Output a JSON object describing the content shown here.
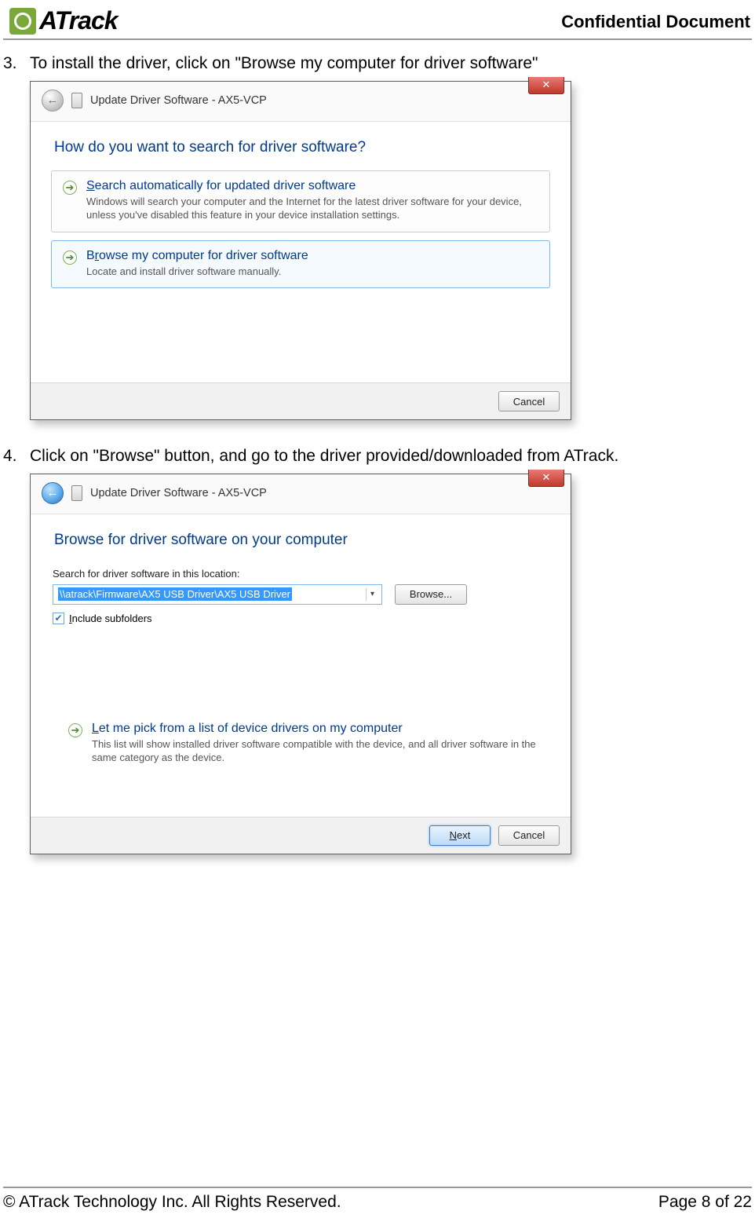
{
  "header": {
    "logo_text": "ATrack",
    "confidential": "Confidential  Document"
  },
  "steps": {
    "s3": {
      "num": "3.",
      "text": "To install the driver, click on \"Browse my computer for driver software\""
    },
    "s4": {
      "num": "4.",
      "text": "Click on \"Browse\" button, and go to the driver provided/downloaded from ATrack."
    }
  },
  "dlg1": {
    "title": "Update Driver Software - AX5-VCP",
    "heading": "How do you want to search for driver software?",
    "opt1_title_pre": "S",
    "opt1_title_rest": "earch automatically for updated driver software",
    "opt1_desc": "Windows will search your computer and the Internet for the latest driver software for your device, unless you've disabled this feature in your device installation settings.",
    "opt2_title_pre": "B",
    "opt2_title_mid": "r",
    "opt2_title_rest": "owse my computer for driver software",
    "opt2_desc": "Locate and install driver software manually.",
    "cancel": "Cancel"
  },
  "dlg2": {
    "title": "Update Driver Software - AX5-VCP",
    "heading": "Browse for driver software on your computer",
    "search_label": "Search for driver software in this location:",
    "path_value": "\\\\atrack\\Firmware\\AX5 USB Driver\\AX5 USB Driver",
    "browse": "Browse...",
    "include_pre": "I",
    "include_rest": "nclude subfolders",
    "opt_title_pre": "L",
    "opt_title_rest": "et me pick from a list of device drivers on my computer",
    "opt_desc": "This list will show installed driver software compatible with the device, and all driver software in the same category as the device.",
    "next_pre": "N",
    "next_rest": "ext",
    "cancel": "Cancel"
  },
  "footer": {
    "copyright": "© ATrack Technology Inc. All Rights Reserved.",
    "page": "Page 8 of 22"
  }
}
